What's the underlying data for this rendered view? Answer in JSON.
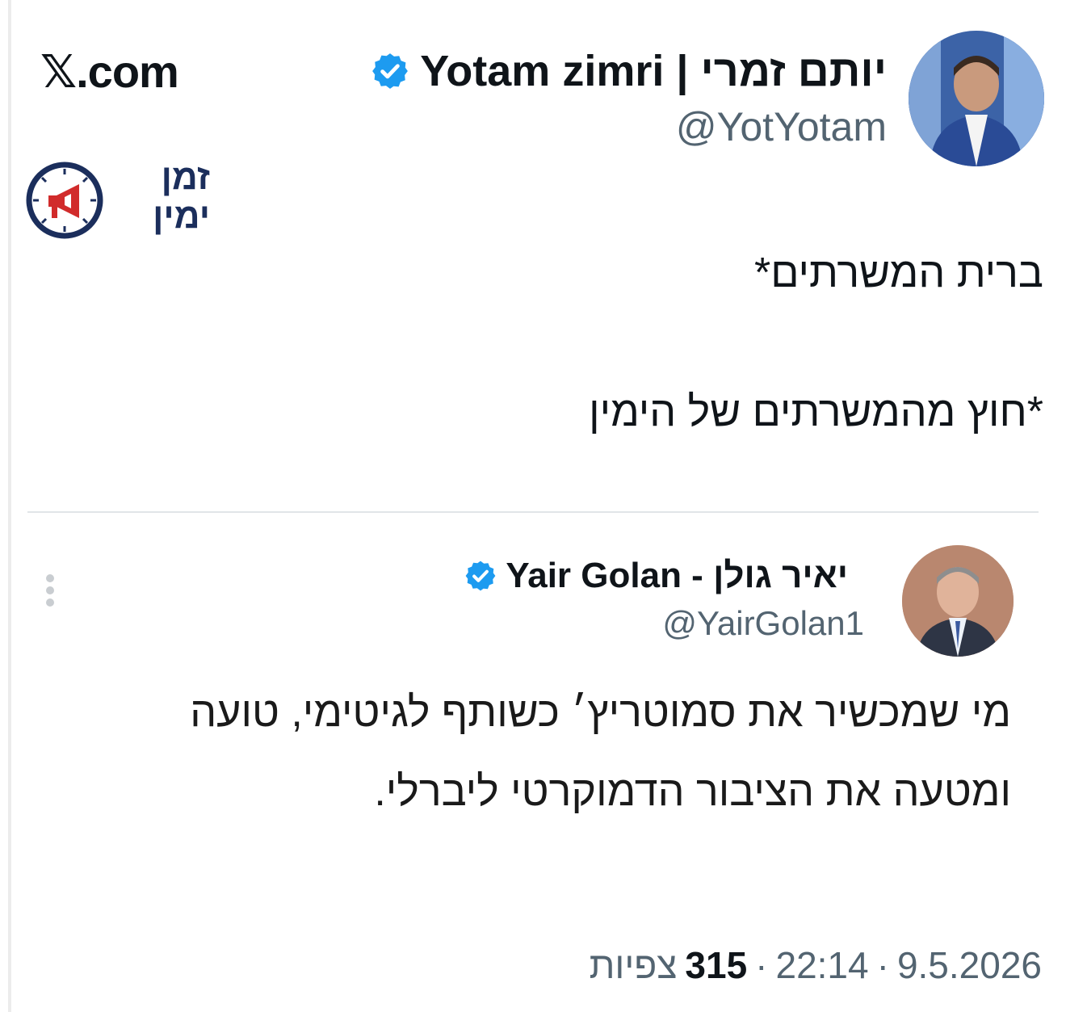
{
  "site": {
    "brand": "𝕏.com"
  },
  "channel_logo": {
    "line1": "זמן",
    "line2": "ימין"
  },
  "tweet": {
    "author_name": "Yotam zimri | יותם זמרי",
    "handle": "@YotYotam",
    "verified": true,
    "text_line1": "ברית המשרתים*",
    "text_line2": "*חוץ מהמשרתים של הימין"
  },
  "quoted_tweet": {
    "author_name": "Yair Golan - יאיר גולן",
    "handle": "@YairGolan1",
    "verified": true,
    "text_line1": "מי שמכשיר את סמוטריץ׳ כשותף לגיטימי, טועה",
    "text_line2": "ומטעה את הציבור הדמוקרטי ליברלי."
  },
  "meta": {
    "date": "9.5.2026",
    "time": "22:14",
    "separator": "·",
    "views_count": "315",
    "views_label": "צפיות"
  },
  "colors": {
    "verified_blue": "#1d9bf0",
    "logo_navy": "#1b2e5c",
    "logo_red": "#d12b2b",
    "secondary_text": "#536471"
  }
}
